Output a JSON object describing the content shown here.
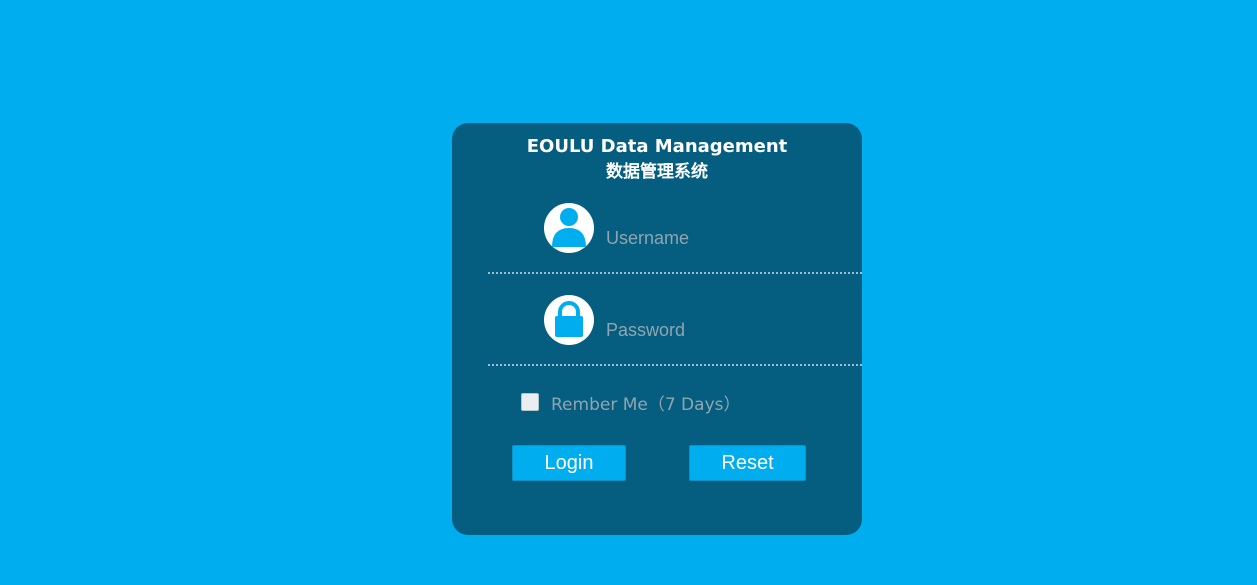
{
  "app": {
    "title_en": "EOULU Data Management",
    "title_cn": "数据管理系统"
  },
  "form": {
    "username_placeholder": "Username",
    "password_placeholder": "Password",
    "remember_label": "Rember Me（7 Days）",
    "remember_checked": false,
    "login_label": "Login",
    "reset_label": "Reset"
  },
  "icons": {
    "username": "user-icon",
    "password": "lock-icon"
  },
  "colors": {
    "background": "#00adef",
    "card": "#055e80",
    "accent": "#00adef",
    "placeholder_text": "#8fa5b0"
  }
}
